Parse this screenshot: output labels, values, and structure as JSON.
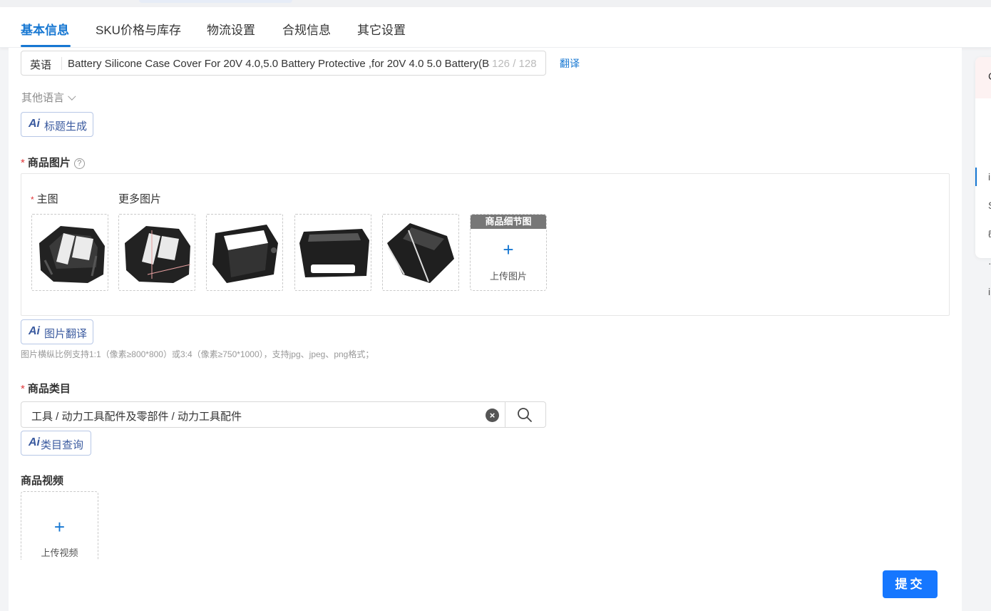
{
  "tabs": [
    {
      "label": "基本信息",
      "active": true
    },
    {
      "label": "SKU价格与库存",
      "active": false
    },
    {
      "label": "物流设置",
      "active": false
    },
    {
      "label": "合规信息",
      "active": false
    },
    {
      "label": "其它设置",
      "active": false
    }
  ],
  "title_field": {
    "language": "英语",
    "value": "Battery Silicone Case Cover For 20V 4.0,5.0 Battery Protective ,for 20V 4.0 5.0 Battery(Battery Not Included)",
    "char_count": "126 / 128",
    "translate_label": "翻译"
  },
  "other_languages_label": "其他语言",
  "ai_title_button": {
    "ai_mark": "Ai",
    "label": "标题生成"
  },
  "images": {
    "section_label": "商品图片",
    "help_icon": "question-circle-icon",
    "main_label": "主图",
    "more_label": "更多图片",
    "thumbnails": [
      {
        "alt": "主图"
      },
      {
        "alt": "更多图片 1"
      },
      {
        "alt": "更多图片 2"
      },
      {
        "alt": "更多图片 3"
      },
      {
        "alt": "更多图片 4"
      }
    ],
    "detail_tag": "商品细节图",
    "upload_label": "上传图片",
    "ai_translate_button": {
      "ai_mark": "Ai",
      "label": "图片翻译"
    },
    "hint": "图片横纵比例支持1:1（像素≥800*800）或3:4（像素≥750*1000），支持jpg、jpeg、png格式；"
  },
  "category": {
    "section_label": "商品类目",
    "value": "工具 / 动力工具配件及零部件 / 动力工具配件",
    "ai_button": {
      "ai_mark": "Ai",
      "label": "类目查询"
    }
  },
  "video": {
    "section_label": "商品视频",
    "upload_label": "上传视频"
  },
  "submit_label": "提交",
  "colors": {
    "accent": "#1677d2",
    "primary_button": "#1677ff",
    "required": "#e0383a"
  }
}
